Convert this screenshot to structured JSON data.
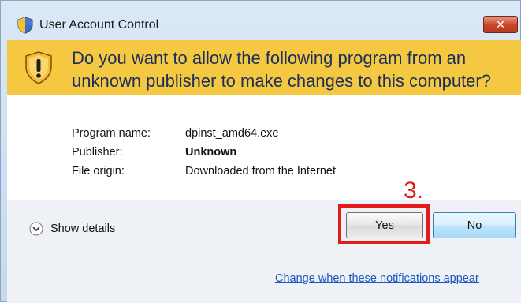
{
  "window": {
    "title": "User Account Control",
    "close_label": "✕"
  },
  "banner": {
    "question": "Do you want to allow the following program from an unknown publisher to make changes to this computer?"
  },
  "details": {
    "program_name_label": "Program name:",
    "program_name_value": "dpinst_amd64.exe",
    "publisher_label": "Publisher:",
    "publisher_value": "Unknown",
    "file_origin_label": "File origin:",
    "file_origin_value": "Downloaded from the Internet"
  },
  "footer": {
    "show_details_label": "Show details",
    "yes_label": "Yes",
    "no_label": "No",
    "change_link": "Change when these notifications appear"
  },
  "annotation": {
    "step_label": "3.",
    "color": "#e41b1b"
  },
  "icons": [
    "uac-shield-icon",
    "warning-shield-icon",
    "chevron-down-icon",
    "close-icon"
  ]
}
